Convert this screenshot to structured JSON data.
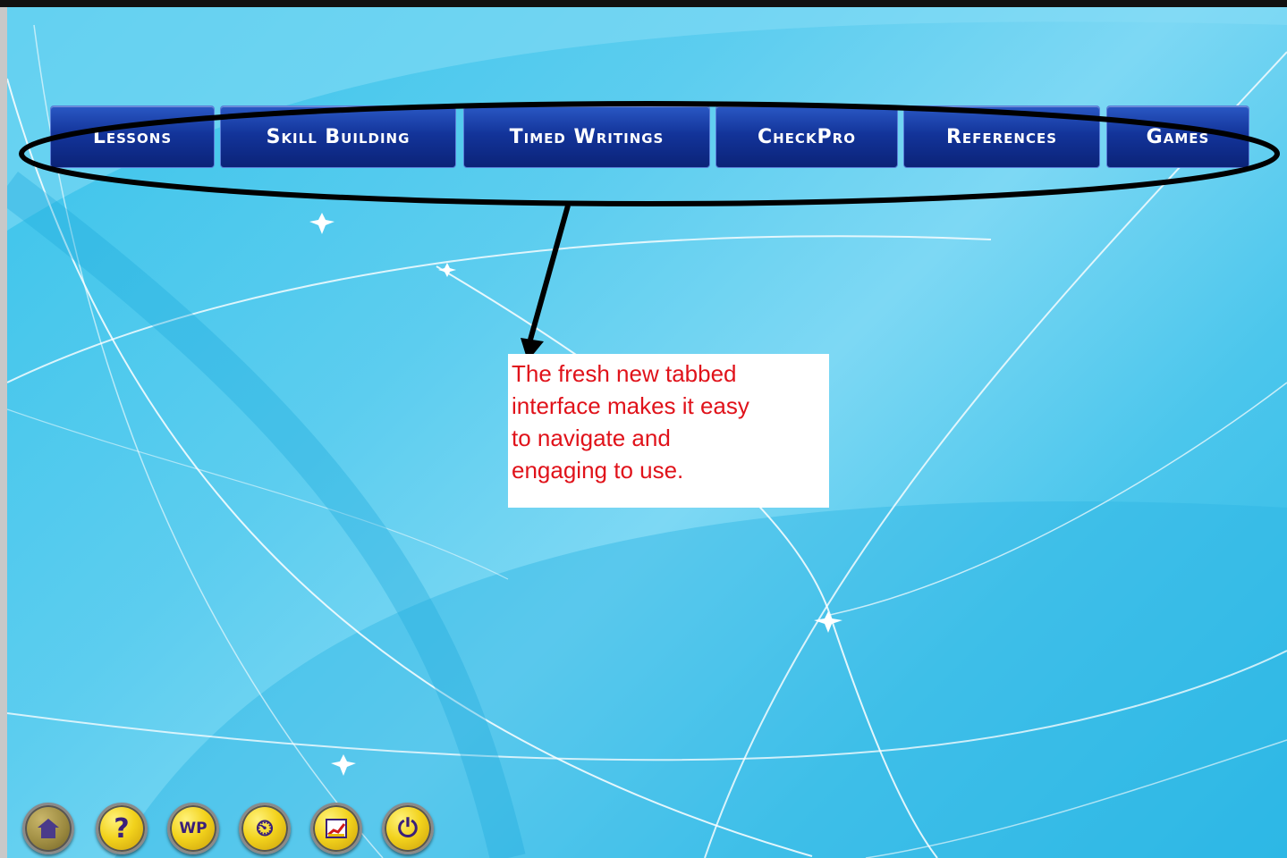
{
  "tabs": [
    {
      "label": "Lessons"
    },
    {
      "label": "Skill Building"
    },
    {
      "label": "Timed Writings"
    },
    {
      "label": "CheckPro"
    },
    {
      "label": "References"
    },
    {
      "label": "Games"
    }
  ],
  "callout": {
    "lines": [
      "The fresh new tabbed",
      "interface makes it easy",
      "to navigate and",
      "engaging to use."
    ]
  },
  "bottom_buttons": [
    {
      "icon": "home-icon"
    },
    {
      "icon": "help-icon",
      "glyph": "?"
    },
    {
      "icon": "word-processor-icon",
      "glyph": "WP"
    },
    {
      "icon": "timer-icon",
      "glyph": "⏲"
    },
    {
      "icon": "chart-icon",
      "glyph": "▦"
    },
    {
      "icon": "power-icon",
      "glyph": "⏻"
    }
  ],
  "colors": {
    "tab_blue": "#13349a",
    "callout_text": "#e0121a",
    "button_gold": "#f2d21c",
    "icon_purple": "#3a1f7a"
  }
}
